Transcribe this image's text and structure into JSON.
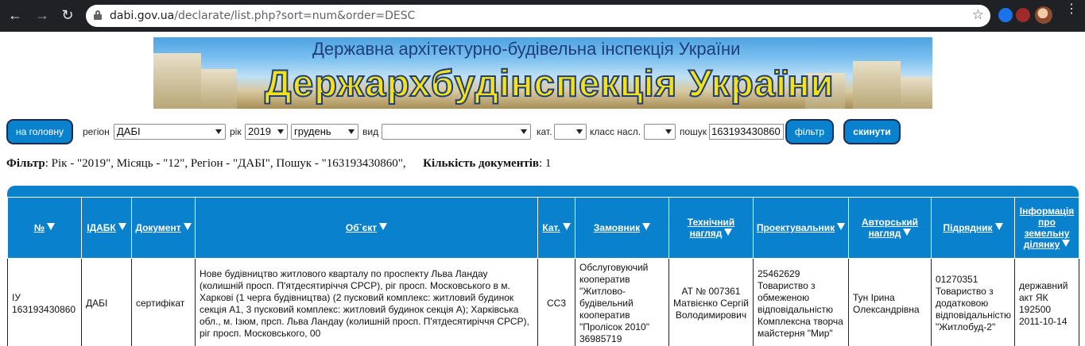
{
  "browser": {
    "url_host": "dabi.gov.ua",
    "url_path": "/declarate/list.php?sort=num&order=DESC"
  },
  "banner": {
    "line1": "Державна архітектурно-будівельна інспекція України",
    "line2": "Держархбудінспекція України"
  },
  "filters": {
    "home_button": "на головну",
    "region_label": "регіон",
    "region_value": "ДАБІ",
    "year_label": "рік",
    "year_value": "2019",
    "month_value": "грудень",
    "type_label": "вид",
    "type_value": "",
    "category_label": "кат.",
    "category_value": "",
    "class_label": "класс насл.",
    "class_value": "",
    "search_label": "пошук",
    "search_value": "163193430860",
    "filter_button": "фільтр",
    "reset_button": "скинути"
  },
  "summary": {
    "filter_label": "Фільтр",
    "filter_text": ": Рік - \"2019\", Місяць - \"12\", Регіон - \"ДАБІ\", Пошук - \"163193430860\",",
    "count_label": "Кількість документів",
    "count_text": ": 1"
  },
  "table": {
    "headers": {
      "num": "№",
      "idabk": "ІДАБК",
      "document": "Документ",
      "object": "Об`єкт",
      "cat": "Кат.",
      "customer": "Замовник",
      "tech_supervision": "Технічний нагляд",
      "designer": "Проектувальник",
      "author_supervision": "Авторський нагляд",
      "contractor": "Підрядник",
      "land_info": "Інформація про земельну ділянку"
    },
    "row": {
      "num": "ІУ 163193430860",
      "idabk": "ДАБІ",
      "document": "сертифікат",
      "object": "Нове будівництво житлового кварталу по проспекту Льва Ландау (колишній просп. П'ятдесятиріччя СРСР), ріг просп. Московського в м. Харкові (1 черга будівництва) (2 пусковий комплекс: житловий будинок секція А1, 3 пусковий комплекс: житловий будинок секція А); Харківська обл., м. Ізюм, прсп. Льва Ландау (колишній просп. П'ятдесятиріччя СРСР), ріг просп. Московського, 00",
      "cat": "СС3",
      "customer": "Обслуговуючий кооператив \"Житлово-будівельний кооператив \"Пролісок 2010\" 36985719",
      "tech_supervision": "АТ № 007361 Матвієнко Сергій Володимирович",
      "designer": "25462629 Товариство з обмеженою відповідальністю Комплексна творча майстерня \"Мир\"",
      "author_supervision": "Тун Ірина Олександрівна",
      "contractor": "01270351 Товариство з додатковою відповідальністю \"Житлобуд-2\"",
      "land_info": "державний акт ЯК 192500 2011-10-14"
    }
  }
}
